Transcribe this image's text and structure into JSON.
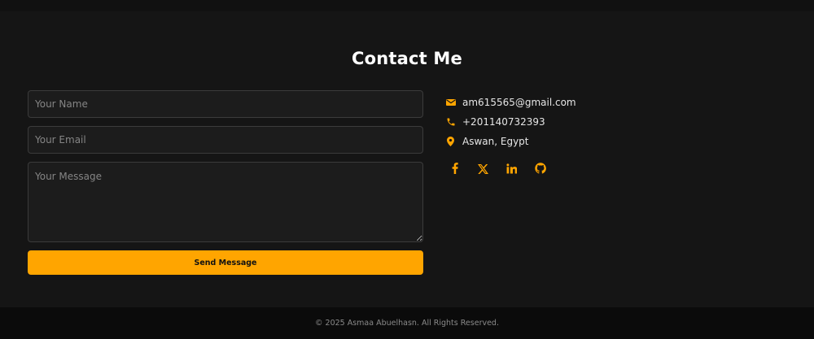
{
  "colors": {
    "accent": "#ffa500",
    "background": "#151515",
    "footer_background": "#0b0b0b",
    "field_background": "#1c1c1c"
  },
  "contact": {
    "title": "Contact Me",
    "form": {
      "name_placeholder": "Your Name",
      "email_placeholder": "Your Email",
      "message_placeholder": "Your Message",
      "send_label": "Send Message"
    },
    "info": {
      "email": "am615565@gmail.com",
      "phone": "+201140732393",
      "location": "Aswan, Egypt"
    },
    "social": [
      {
        "name": "facebook",
        "icon": "facebook-icon",
        "glyph": "f"
      },
      {
        "name": "x",
        "icon": "x-icon",
        "glyph": "𝕏"
      },
      {
        "name": "linkedin",
        "icon": "linkedin-icon",
        "glyph": "in"
      },
      {
        "name": "github",
        "icon": "github-icon",
        "glyph": ""
      }
    ]
  },
  "footer": {
    "copyright": "© 2025 Asmaa Abuelhasn. All Rights Reserved."
  }
}
